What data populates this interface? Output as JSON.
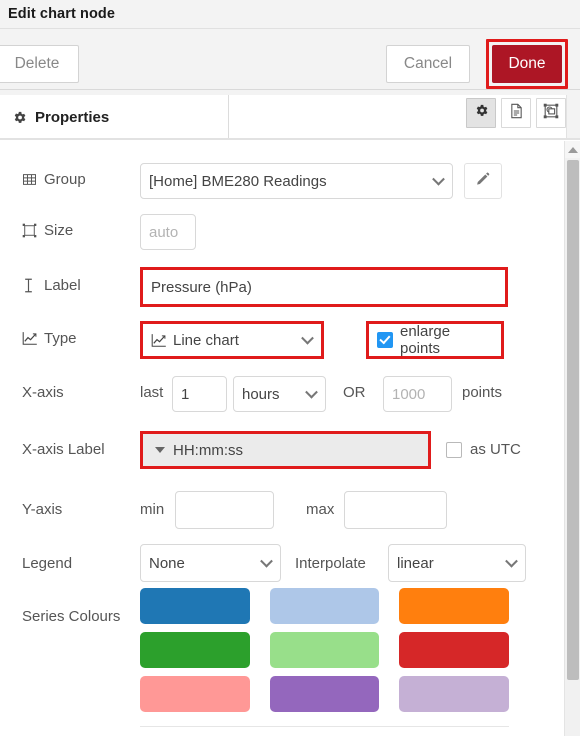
{
  "window": {
    "title": "Edit chart node"
  },
  "toolbar": {
    "delete_label": "Delete",
    "cancel_label": "Cancel",
    "done_label": "Done",
    "done_color": "#ad1625",
    "annotation_color": "#e01b1b"
  },
  "tabs": {
    "active_label": "Properties",
    "icon_buttons": [
      {
        "name": "gear-icon",
        "selected": true
      },
      {
        "name": "description-icon",
        "selected": false
      },
      {
        "name": "appearance-icon",
        "selected": false
      }
    ]
  },
  "form": {
    "group": {
      "label": "Group",
      "icon": "table-icon",
      "value": "[Home] BME280 Readings",
      "edit_button_icon": "pencil-icon"
    },
    "size": {
      "label": "Size",
      "icon": "resize-icon",
      "placeholder": "auto"
    },
    "chart_label": {
      "label": "Label",
      "icon": "text-cursor-icon",
      "value": "Pressure (hPa)",
      "highlighted": true
    },
    "type": {
      "label": "Type",
      "icon": "line-chart-icon",
      "value": "Line chart",
      "highlighted": true,
      "enlarge_points_label": "enlarge points",
      "enlarge_points_checked": true
    },
    "xaxis": {
      "label": "X-axis",
      "prefix": "last",
      "amount_value": "1",
      "unit_value": "hours",
      "or_label": "OR",
      "points_placeholder": "1000",
      "points_label": "points"
    },
    "xaxis_label": {
      "label": "X-axis Label",
      "value": "HH:mm:ss",
      "highlighted": true,
      "as_utc_label": "as UTC",
      "as_utc_checked": false
    },
    "yaxis": {
      "label": "Y-axis",
      "min_label": "min",
      "min_value": "",
      "max_label": "max",
      "max_value": ""
    },
    "legend": {
      "label": "Legend",
      "value": "None",
      "interpolate_label": "Interpolate",
      "interpolate_value": "linear"
    },
    "series_colours": {
      "label": "Series Colours",
      "rows": [
        [
          "#1f77b4",
          "#aec7e8",
          "#ff7f0e"
        ],
        [
          "#2ca02c",
          "#98df8a",
          "#d62728"
        ],
        [
          "#ff9896",
          "#9467bd",
          "#c5b0d5"
        ]
      ]
    }
  }
}
